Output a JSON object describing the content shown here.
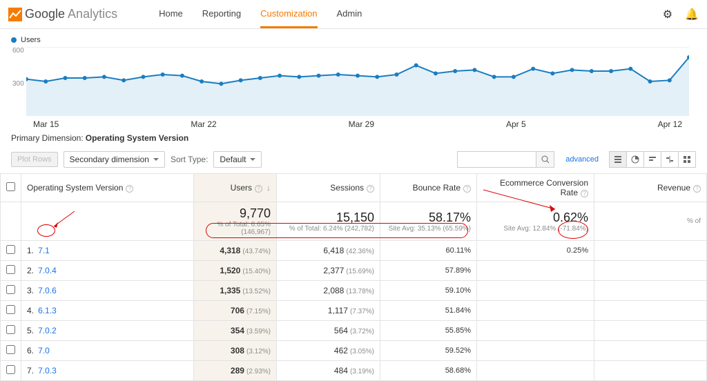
{
  "nav": {
    "brand1": "Google",
    "brand2": "Analytics",
    "tabs": [
      "Home",
      "Reporting",
      "Customization",
      "Admin"
    ],
    "active_tab": 2
  },
  "chart": {
    "legend": "Users",
    "y_ticks": [
      "600",
      "300"
    ],
    "x_ticks": [
      "Mar 15",
      "Mar 22",
      "Mar 29",
      "Apr 5",
      "Apr 12"
    ]
  },
  "chart_data": {
    "type": "line",
    "x": [
      "Mar 12",
      "Mar 13",
      "Mar 14",
      "Mar 15",
      "Mar 16",
      "Mar 17",
      "Mar 18",
      "Mar 19",
      "Mar 20",
      "Mar 21",
      "Mar 22",
      "Mar 23",
      "Mar 24",
      "Mar 25",
      "Mar 26",
      "Mar 27",
      "Mar 28",
      "Mar 29",
      "Mar 30",
      "Mar 31",
      "Apr 1",
      "Apr 2",
      "Apr 3",
      "Apr 4",
      "Apr 5",
      "Apr 6",
      "Apr 7",
      "Apr 8",
      "Apr 9",
      "Apr 10",
      "Apr 11",
      "Apr 12",
      "Apr 13",
      "Apr 14",
      "Apr 15"
    ],
    "series": [
      {
        "name": "Users",
        "values": [
          320,
          300,
          330,
          330,
          340,
          310,
          340,
          360,
          350,
          300,
          280,
          310,
          330,
          350,
          340,
          350,
          360,
          350,
          340,
          360,
          440,
          370,
          390,
          400,
          340,
          340,
          410,
          370,
          400,
          390,
          390,
          410,
          300,
          310,
          510
        ]
      }
    ],
    "ylabel": "Users",
    "ylim": [
      0,
      600
    ]
  },
  "dim_label": "Primary Dimension:",
  "dim_value": "Operating System Version",
  "toolbar": {
    "plot_rows": "Plot Rows",
    "secondary": "Secondary dimension",
    "sort_label": "Sort Type:",
    "sort_value": "Default",
    "search_placeholder": "",
    "advanced": "advanced"
  },
  "columns": {
    "os": "Operating System Version",
    "users": "Users",
    "sessions": "Sessions",
    "bounce": "Bounce Rate",
    "ecr": "Ecommerce Conversion Rate",
    "revenue": "Revenue"
  },
  "totals": {
    "users": "9,770",
    "users_sub": "% of Total: 6.65% (146,967)",
    "sessions": "15,150",
    "sessions_sub": "% of Total: 6.24% (242,782)",
    "bounce": "58.17%",
    "bounce_sub": "Site Avg: 35.13% (65.59%)",
    "ecr": "0.62%",
    "ecr_sub": "Site Avg: 12.84% (-71.84%)",
    "revenue_sub": "% of"
  },
  "rows": [
    {
      "n": "1.",
      "os": "7.1",
      "users": "4,318",
      "users_p": "(43.74%)",
      "sessions": "6,418",
      "sessions_p": "(42.36%)",
      "bounce": "60.11%",
      "ecr": "0.25%"
    },
    {
      "n": "2.",
      "os": "7.0.4",
      "users": "1,520",
      "users_p": "(15.40%)",
      "sessions": "2,377",
      "sessions_p": "(15.69%)",
      "bounce": "57.89%"
    },
    {
      "n": "3.",
      "os": "7.0.6",
      "users": "1,335",
      "users_p": "(13.52%)",
      "sessions": "2,088",
      "sessions_p": "(13.78%)",
      "bounce": "59.10%"
    },
    {
      "n": "4.",
      "os": "6.1.3",
      "users": "706",
      "users_p": "(7.15%)",
      "sessions": "1,117",
      "sessions_p": "(7.37%)",
      "bounce": "51.84%"
    },
    {
      "n": "5.",
      "os": "7.0.2",
      "users": "354",
      "users_p": "(3.59%)",
      "sessions": "564",
      "sessions_p": "(3.72%)",
      "bounce": "55.85%"
    },
    {
      "n": "6.",
      "os": "7.0",
      "users": "308",
      "users_p": "(3.12%)",
      "sessions": "462",
      "sessions_p": "(3.05%)",
      "bounce": "59.52%"
    },
    {
      "n": "7.",
      "os": "7.0.3",
      "users": "289",
      "users_p": "(2.93%)",
      "sessions": "484",
      "sessions_p": "(3.19%)",
      "bounce": "58.68%"
    }
  ]
}
